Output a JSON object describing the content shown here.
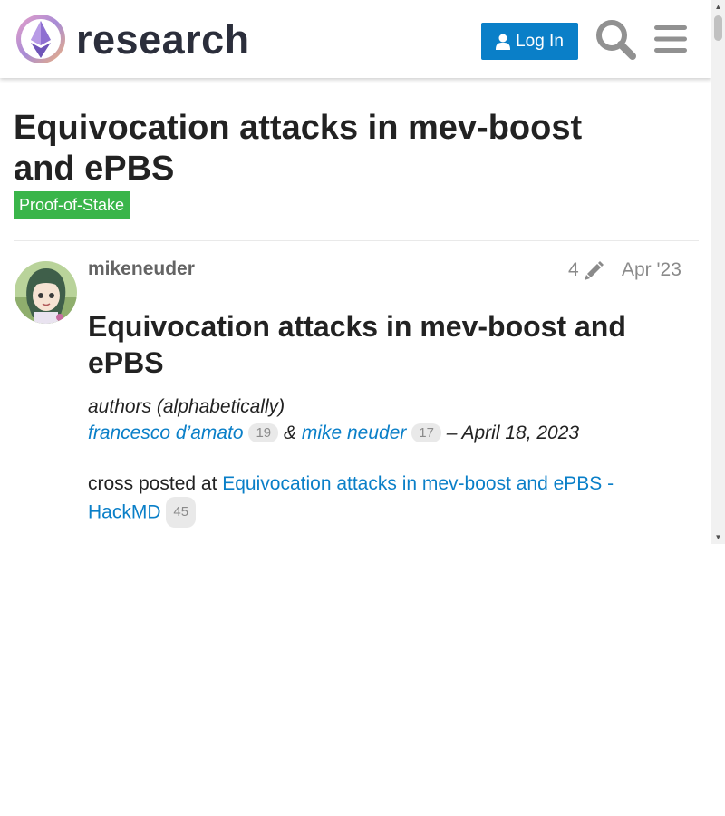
{
  "header": {
    "logo_text": "research",
    "login_label": "Log In"
  },
  "topic": {
    "title": "Equivocation attacks in mev-boost and ePBS",
    "category": "Proof-of-Stake",
    "category_color": "#3ab54a"
  },
  "post": {
    "username": "mikeneuder",
    "edit_count": "4",
    "date": "Apr '23",
    "heading": "Equivocation attacks in mev-boost and ePBS",
    "authors_label": "authors (alphabetically)",
    "author1": "francesco d’amato",
    "author1_clicks": "19",
    "amp": "&",
    "author2": "mike neuder",
    "author2_clicks": "17",
    "date_text": "– April 18, 2023",
    "crosspost_prefix": "cross posted at",
    "crosspost_link": "Equivocation attacks in mev-boost and ePBS - HackMD",
    "crosspost_clicks": "45"
  },
  "colors": {
    "link": "#0a7fc8",
    "button": "#0a7fc8"
  }
}
